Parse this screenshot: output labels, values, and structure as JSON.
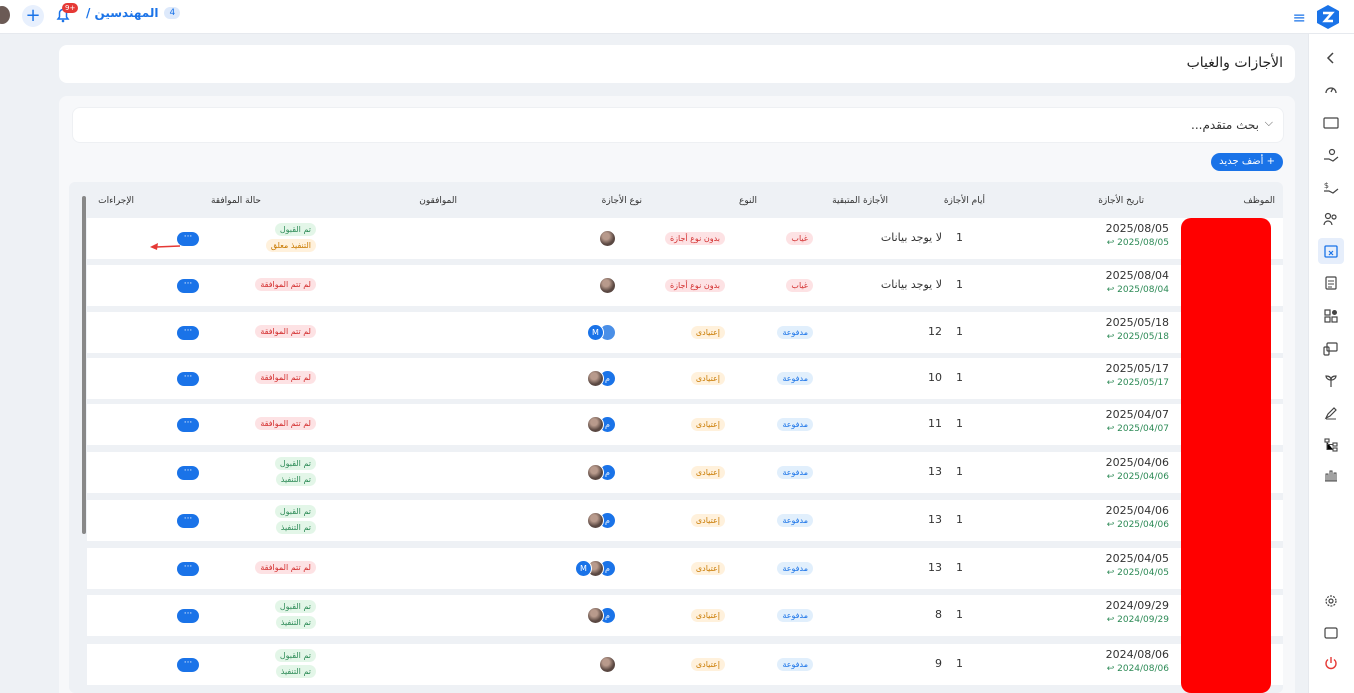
{
  "header": {
    "dept_count": "4",
    "dept_name": "المهندسين /",
    "bell_badge": "+9",
    "add_symbol": "+"
  },
  "page": {
    "title": "الأجازات والغياب"
  },
  "search": {
    "label": "بحث متقدم...",
    "chevron": "⌵"
  },
  "toolbar": {
    "add_new": "+ أضف جديد"
  },
  "table": {
    "columns": {
      "employee": "الموظف",
      "date": "تاريخ الأجازة",
      "days": "أيام الأجازة",
      "remaining": "الأجازة المتبقية",
      "type": "النوع",
      "leave_type": "نوع الأجازة",
      "approvers": "الموافقون",
      "status": "حالة الموافقة",
      "actions": "الإجراءات"
    },
    "action_label": "···",
    "rows": [
      {
        "date": "2025/08/05",
        "date_sub": "2025/08/05 ↩",
        "days": "1",
        "remaining": "لا يوجد بيانات",
        "type": "غياب",
        "leave_type": "بدون نوع أجازة",
        "status1": "تم القبول",
        "status2": "التنفيذ معلق"
      },
      {
        "date": "2025/08/04",
        "date_sub": "2025/08/04 ↩",
        "days": "1",
        "remaining": "لا يوجد بيانات",
        "type": "غياب",
        "leave_type": "بدون نوع أجازة",
        "status1": "لم تتم الموافقة",
        "status2": ""
      },
      {
        "date": "2025/05/18",
        "date_sub": "2025/05/18 ↩",
        "days": "1",
        "remaining": "12",
        "type": "مدفوعة",
        "leave_type": "إعتيادى",
        "status1": "لم تتم الموافقة",
        "status2": ""
      },
      {
        "date": "2025/05/17",
        "date_sub": "2025/05/17 ↩",
        "days": "1",
        "remaining": "10",
        "type": "مدفوعة",
        "leave_type": "إعتيادى",
        "status1": "لم تتم الموافقة",
        "status2": ""
      },
      {
        "date": "2025/04/07",
        "date_sub": "2025/04/07 ↩",
        "days": "1",
        "remaining": "11",
        "type": "مدفوعة",
        "leave_type": "إعتيادى",
        "status1": "لم تتم الموافقة",
        "status2": ""
      },
      {
        "date": "2025/04/06",
        "date_sub": "2025/04/06 ↩",
        "days": "1",
        "remaining": "13",
        "type": "مدفوعة",
        "leave_type": "إعتيادى",
        "status1": "تم القبول",
        "status2": "تم التنفيذ"
      },
      {
        "date": "2025/04/06",
        "date_sub": "2025/04/06 ↩",
        "days": "1",
        "remaining": "13",
        "type": "مدفوعة",
        "leave_type": "إعتيادى",
        "status1": "تم القبول",
        "status2": "تم التنفيذ"
      },
      {
        "date": "2025/04/05",
        "date_sub": "2025/04/05 ↩",
        "days": "1",
        "remaining": "13",
        "type": "مدفوعة",
        "leave_type": "إعتيادى",
        "status1": "لم تتم الموافقة",
        "status2": ""
      },
      {
        "date": "2024/09/29",
        "date_sub": "2024/09/29 ↩",
        "days": "1",
        "remaining": "8",
        "type": "مدفوعة",
        "leave_type": "إعتيادى",
        "status1": "تم القبول",
        "status2": "تم التنفيذ"
      },
      {
        "date": "2024/08/06",
        "date_sub": "2024/08/06 ↩",
        "days": "1",
        "remaining": "9",
        "type": "مدفوعة",
        "leave_type": "إعتيادى",
        "status1": "تم القبول",
        "status2": "تم التنفيذ"
      }
    ],
    "avatar_letters": {
      "m_ar": "م",
      "m_en": "M"
    }
  },
  "colors": {
    "accent": "#1a73e8",
    "danger": "#e53935",
    "redaction": "#ff0000"
  }
}
